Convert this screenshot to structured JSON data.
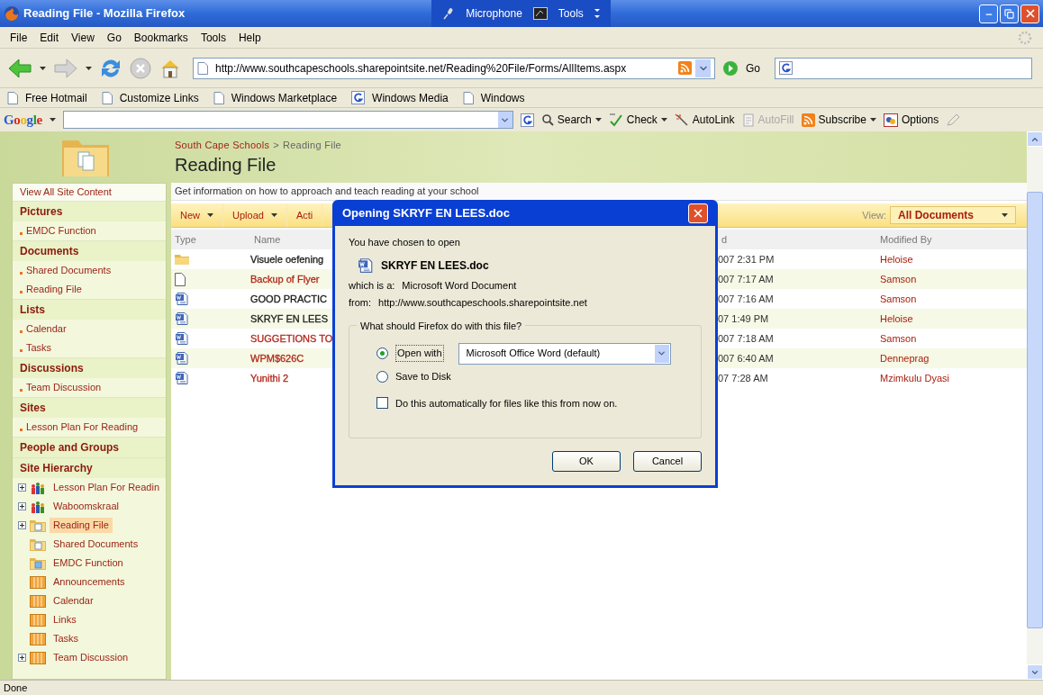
{
  "window": {
    "title": "Reading File - Mozilla Firefox",
    "language_bar": [
      "Microphone",
      "Tools"
    ]
  },
  "menu": [
    "File",
    "Edit",
    "View",
    "Go",
    "Bookmarks",
    "Tools",
    "Help"
  ],
  "navigation": {
    "url": "http://www.southcapeschools.sharepointsite.net/Reading%20File/Forms/AllItems.aspx",
    "go": "Go"
  },
  "bookmarks": [
    {
      "label": "Free Hotmail",
      "kind": "page"
    },
    {
      "label": "Customize Links",
      "kind": "page"
    },
    {
      "label": "Windows Marketplace",
      "kind": "page"
    },
    {
      "label": "Windows Media",
      "kind": "google"
    },
    {
      "label": "Windows",
      "kind": "page"
    }
  ],
  "google_toolbar": {
    "logo": "Google",
    "buttons": [
      {
        "label": "Search",
        "kind": "search",
        "menu": true,
        "disabled": false
      },
      {
        "label": "Check",
        "kind": "spell",
        "menu": true,
        "disabled": false
      },
      {
        "label": "AutoLink",
        "kind": "wand",
        "menu": false,
        "disabled": false
      },
      {
        "label": "AutoFill",
        "kind": "form",
        "menu": false,
        "disabled": true
      },
      {
        "label": "Subscribe",
        "kind": "rss",
        "menu": true,
        "disabled": false
      },
      {
        "label": "Options",
        "kind": "options",
        "menu": false,
        "disabled": false
      }
    ]
  },
  "breadcrumb": {
    "items": [
      "South Cape Schools",
      "Reading File"
    ],
    "separator": ">"
  },
  "page_title": "Reading File",
  "description": "Get information on how to approach and teach reading at your school",
  "quick_launch": {
    "view_all": "View All Site Content",
    "sections": [
      {
        "heading": "Pictures",
        "items": [
          "EMDC Function"
        ]
      },
      {
        "heading": "Documents",
        "items": [
          "Shared Documents",
          "Reading File"
        ]
      },
      {
        "heading": "Lists",
        "items": [
          "Calendar",
          "Tasks"
        ]
      },
      {
        "heading": "Discussions",
        "items": [
          "Team Discussion"
        ]
      },
      {
        "heading": "Sites",
        "items": [
          "Lesson Plan For Reading"
        ]
      },
      {
        "heading": "People and Groups"
      }
    ],
    "hierarchy_heading": "Site Hierarchy",
    "hierarchy": [
      {
        "label": "Lesson Plan For Readin",
        "kind": "site",
        "expandable": true,
        "selected": false
      },
      {
        "label": "Waboomskraal",
        "kind": "site",
        "expandable": true,
        "selected": false
      },
      {
        "label": "Reading File",
        "kind": "library",
        "expandable": true,
        "selected": true
      },
      {
        "label": "Shared Documents",
        "kind": "library",
        "expandable": false,
        "selected": false
      },
      {
        "label": "EMDC Function",
        "kind": "picture_library",
        "expandable": false,
        "selected": false
      },
      {
        "label": "Announcements",
        "kind": "list",
        "expandable": false,
        "selected": false
      },
      {
        "label": "Calendar",
        "kind": "list",
        "expandable": false,
        "selected": false
      },
      {
        "label": "Links",
        "kind": "list",
        "expandable": false,
        "selected": false
      },
      {
        "label": "Tasks",
        "kind": "list",
        "expandable": false,
        "selected": false
      },
      {
        "label": "Team Discussion",
        "kind": "list",
        "expandable": true,
        "selected": false
      }
    ]
  },
  "list_toolbar": {
    "buttons": [
      {
        "label": "New",
        "menu": true
      },
      {
        "label": "Upload",
        "menu": true
      },
      {
        "label": "Acti",
        "menu": false
      }
    ],
    "view_label": "View:",
    "view": "All Documents"
  },
  "table": {
    "columns": [
      "Type",
      "Name",
      "d",
      "Modified By"
    ],
    "rows": [
      {
        "kind": "folder",
        "name": "Visuele oefening",
        "color": "#1a1a1a",
        "modified": "007 2:31 PM",
        "modified_by": "Heloise"
      },
      {
        "kind": "file",
        "name": "Backup of Flyer",
        "color": "#b0281a",
        "modified": "007 7:17 AM",
        "modified_by": "Samson"
      },
      {
        "kind": "word",
        "name": "GOOD PRACTIC",
        "color": "#1a1a1a",
        "modified": "007 7:16 AM",
        "modified_by": "Samson"
      },
      {
        "kind": "word",
        "name": "SKRYF EN LEES",
        "color": "#1a1a1a",
        "modified": "07 1:49 PM",
        "modified_by": "Heloise"
      },
      {
        "kind": "word",
        "name": "SUGGETIONS TO",
        "color": "#b0281a",
        "modified": "007 7:18 AM",
        "modified_by": "Samson"
      },
      {
        "kind": "word",
        "name": "WPM$626C",
        "color": "#b0281a",
        "modified": "007 6:40 AM",
        "modified_by": "Denneprag"
      },
      {
        "kind": "word",
        "name": "Yunithi 2",
        "color": "#b0281a",
        "modified": "07 7:28 AM",
        "modified_by": "Mzimkulu Dyasi"
      }
    ]
  },
  "dialog": {
    "title": "Opening SKRYF EN LEES.doc",
    "intro": "You have chosen to open",
    "file": "SKRYF EN LEES.doc",
    "type_label": "which is a:",
    "type": "Microsoft Word Document",
    "from_label": "from:",
    "from": "http://www.southcapeschools.sharepointsite.net",
    "group": "What should Firefox do with this file?",
    "options": [
      {
        "label": "Open with",
        "selected": true
      },
      {
        "label": "Save to Disk",
        "selected": false
      }
    ],
    "application": "Microsoft Office Word (default)",
    "auto": {
      "label": "Do this automatically for files like this from now on.",
      "checked": false
    },
    "buttons": [
      "OK",
      "Cancel"
    ]
  },
  "status_bar": "Done"
}
